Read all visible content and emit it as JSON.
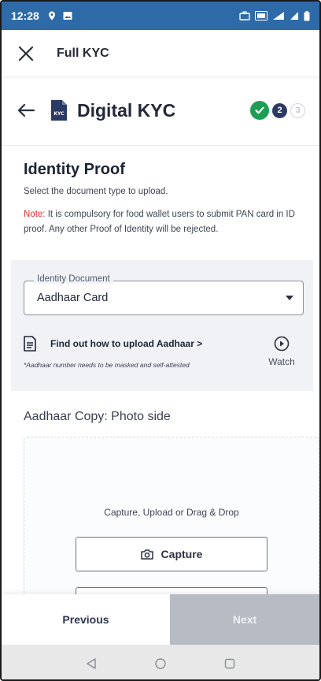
{
  "status_bar": {
    "time": "12:28",
    "icons": [
      "location-icon",
      "gallery-icon",
      "briefcase-icon",
      "volte-icon",
      "signal-icon",
      "signal-icon",
      "battery-icon"
    ]
  },
  "app_bar": {
    "title": "Full KYC",
    "close_icon": "close-icon"
  },
  "kyc_header": {
    "title": "Digital KYC",
    "icon_text": "KYC",
    "steps": [
      {
        "label": "",
        "state": "done"
      },
      {
        "label": "2",
        "state": "current"
      },
      {
        "label": "3",
        "state": "pending"
      }
    ]
  },
  "identity": {
    "heading": "Identity Proof",
    "subtitle": "Select the document type to upload.",
    "note_label": "Note:",
    "note_text": " It is compulsory for food wallet users to submit PAN card in ID proof. Any other Proof of Identity will be rejected."
  },
  "document_select": {
    "label": "Identity Document",
    "value": "Aadhaar Card"
  },
  "howto": {
    "link": "Find out how to upload Aadhaar >",
    "disclaimer": "*Aadhaar number needs to be masked and self-attested",
    "watch_label": "Watch"
  },
  "upload": {
    "title": "Aadhaar Copy: Photo side",
    "dropzone_text": "Capture, Upload or Drag & Drop",
    "capture_label": "Capture"
  },
  "actions": {
    "previous": "Previous",
    "next": "Next"
  },
  "colors": {
    "status_bar": "#2f6aa8",
    "step_done": "#1e9e55",
    "step_current": "#2b3a63",
    "note_label": "#d9302a",
    "next_disabled": "#b7bbc3"
  }
}
